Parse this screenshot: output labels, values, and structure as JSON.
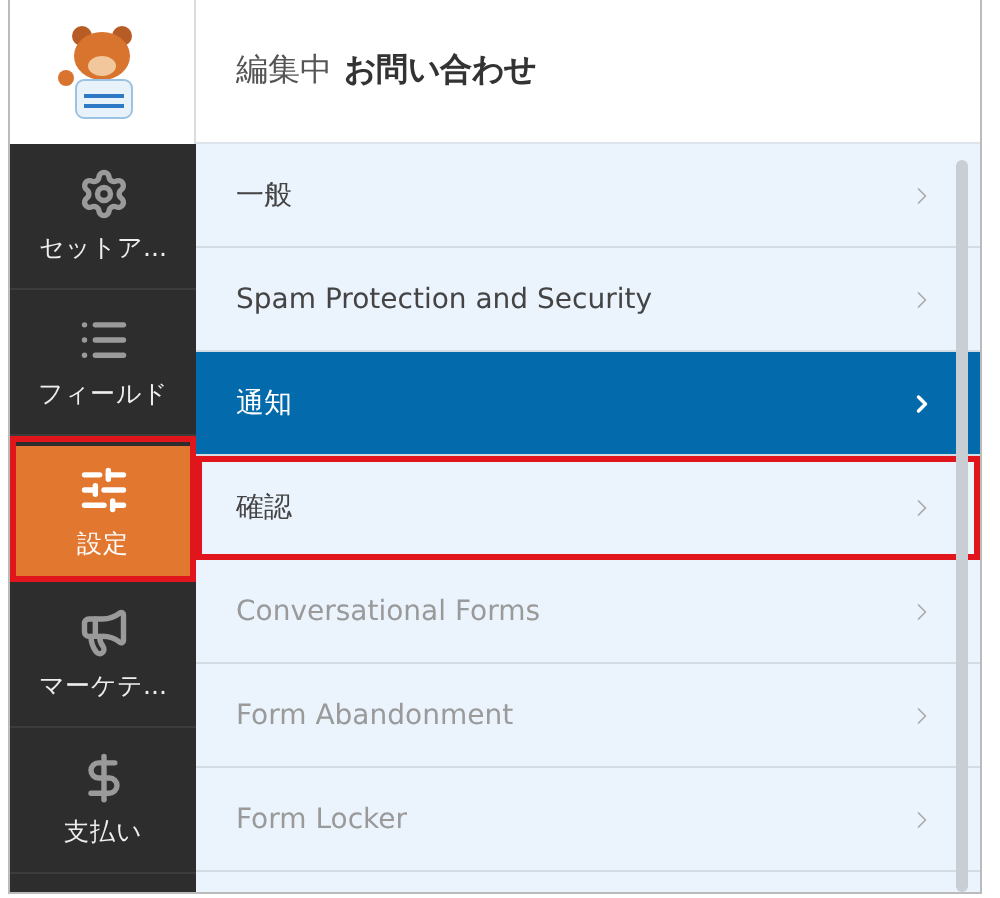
{
  "header": {
    "editing_label": "編集中",
    "form_name": "お問い合わせ"
  },
  "sidebar": {
    "items": [
      {
        "label": "セットア...",
        "selected": false,
        "highlighted": false
      },
      {
        "label": "フィールド",
        "selected": false,
        "highlighted": false
      },
      {
        "label": "設定",
        "selected": true,
        "highlighted": true
      },
      {
        "label": "マーケテ...",
        "selected": false,
        "highlighted": false
      },
      {
        "label": "支払い",
        "selected": false,
        "highlighted": false
      }
    ]
  },
  "settings_menu": {
    "items": [
      {
        "label": "一般",
        "selected": false,
        "disabled": false,
        "highlighted": false
      },
      {
        "label": "Spam Protection and Security",
        "selected": false,
        "disabled": false,
        "highlighted": false
      },
      {
        "label": "通知",
        "selected": true,
        "disabled": false,
        "highlighted": false
      },
      {
        "label": "確認",
        "selected": false,
        "disabled": false,
        "highlighted": true
      },
      {
        "label": "Conversational Forms",
        "selected": false,
        "disabled": true,
        "highlighted": false
      },
      {
        "label": "Form Abandonment",
        "selected": false,
        "disabled": true,
        "highlighted": false
      },
      {
        "label": "Form Locker",
        "selected": false,
        "disabled": true,
        "highlighted": false
      }
    ]
  }
}
